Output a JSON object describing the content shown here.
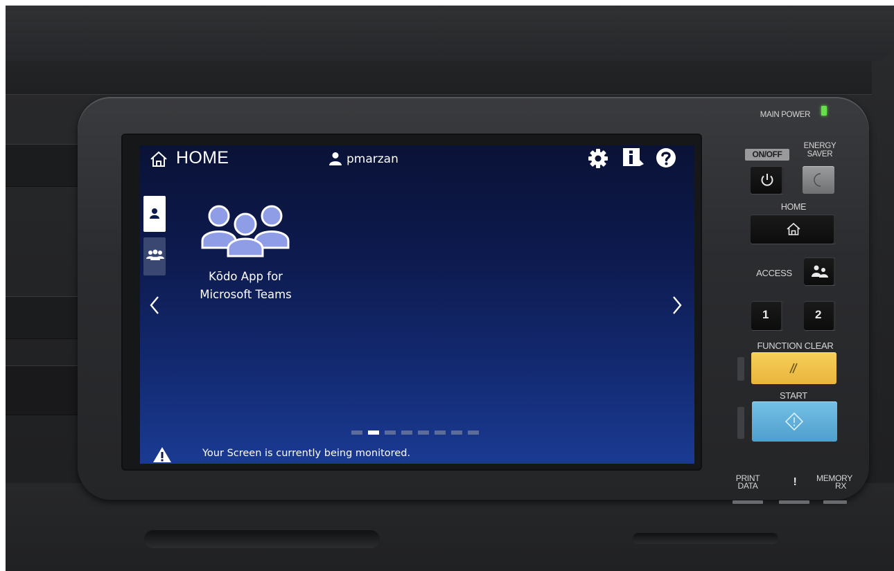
{
  "screen": {
    "header": {
      "title": "HOME",
      "user": "pmarzan",
      "home_icon": "home-icon",
      "user_icon": "user-icon",
      "settings_icon": "gear-icon",
      "info_icon": "info-icon",
      "help_icon": "help-icon"
    },
    "tabs": [
      {
        "icon": "person-icon",
        "active": true
      },
      {
        "icon": "group-icon",
        "active": false
      }
    ],
    "apps": [
      {
        "line1": "Kōdo App for",
        "line2": "Microsoft Teams",
        "icon": "team-people-icon"
      }
    ],
    "pagination": {
      "total": 8,
      "current": 2
    },
    "footer": {
      "warning_icon": "warning-icon",
      "message": "Your Screen is currently being monitored."
    }
  },
  "panel": {
    "main_power": "MAIN POWER",
    "on_off": "ON/OFF",
    "energy_saver_line1": "ENERGY",
    "energy_saver_line2": "SAVER",
    "home": "HOME",
    "access": "ACCESS",
    "key1": "1",
    "key2": "2",
    "function_clear": "FUNCTION CLEAR",
    "start": "START",
    "print_data_line1": "PRINT",
    "print_data_line2": "DATA",
    "alert": "!",
    "memory_rx_line1": "MEMORY",
    "memory_rx_line2": "RX"
  },
  "colors": {
    "screen_top": "#0a1236",
    "screen_bottom": "#1a3a92",
    "function_clear": "#f0c24a",
    "start": "#5fb0da",
    "power_led": "#66e04a"
  }
}
